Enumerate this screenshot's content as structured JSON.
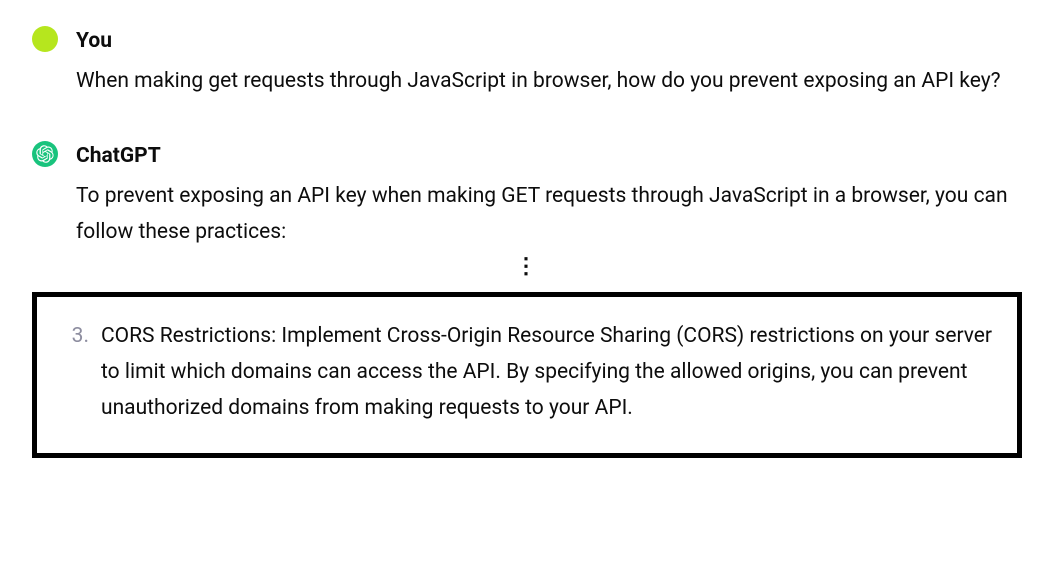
{
  "user": {
    "author": "You",
    "text": "When making get requests through JavaScript in browser, how do you prevent exposing an API key?"
  },
  "assistant": {
    "author": "ChatGPT",
    "intro": "To prevent exposing an API key when making GET requests through JavaScript in a browser, you can follow these practices:"
  },
  "ellipsis": "⋮",
  "item": {
    "number": "3.",
    "text": "CORS Restrictions: Implement Cross-Origin Resource Sharing (CORS) restrictions on your server to limit which domains can access the API. By specifying the allowed origins, you can prevent unauthorized domains from making requests to your API."
  }
}
